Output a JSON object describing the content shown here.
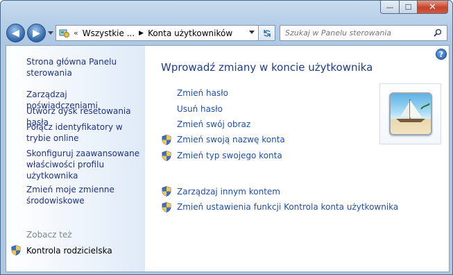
{
  "window": {
    "caption_minimize": "—",
    "caption_maximize": "☐",
    "caption_close": "✕"
  },
  "toolbar": {
    "back_label": "◀",
    "forward_label": "▶",
    "breadcrumb_chevron": "«",
    "breadcrumb": [
      "Wszystkie ...",
      "Konta użytkowników"
    ],
    "breadcrumb_separator": "▶",
    "refresh_label": "↯",
    "search_placeholder": "Szukaj w Panelu sterowania"
  },
  "sidebar": {
    "items": [
      {
        "label": "Strona główna Panelu sterowania"
      },
      {
        "label": "Zarządzaj poświadczeniami"
      },
      {
        "label": "Utwórz dysk resetowania hasła"
      },
      {
        "label": "Połącz identyfikatory w trybie online"
      },
      {
        "label": "Skonfiguruj zaawansowane właściwości profilu użytkownika"
      },
      {
        "label": "Zmień moje zmienne środowiskowe"
      }
    ],
    "see_also_header": "Zobacz też",
    "see_also": [
      {
        "label": "Kontrola rodzicielska",
        "icon": "uac-shield-icon"
      }
    ]
  },
  "main": {
    "help_label": "?",
    "title": "Wprowadź zmiany w koncie użytkownika",
    "tasks": [
      {
        "label": "Zmień hasło",
        "shield": false
      },
      {
        "label": "Usuń hasło",
        "shield": false
      },
      {
        "label": "Zmień swój obraz",
        "shield": false
      },
      {
        "label": "Zmień swoją nazwę konta",
        "shield": true
      },
      {
        "label": "Zmień typ swojego konta",
        "shield": true
      }
    ],
    "other_tasks": [
      {
        "label": "Zarządzaj innym kontem",
        "shield": true
      },
      {
        "label": "Zmień ustawienia funkcji Kontrola konta użytkownika",
        "shield": true
      }
    ],
    "account_picture": "sailboat-beach-picture"
  },
  "colors": {
    "link": "#1f4fa8",
    "title": "#1e3b8c",
    "sidebar_link": "#1e3287",
    "see_also_header": "#7b8796"
  }
}
